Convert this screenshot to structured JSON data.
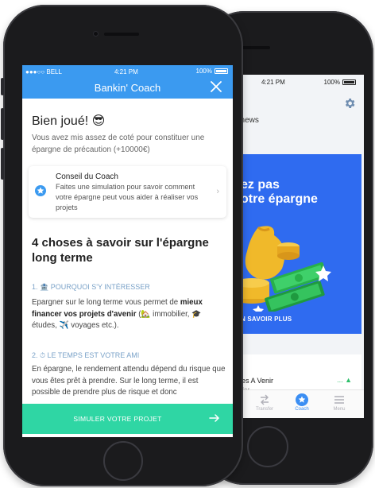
{
  "back_phone": {
    "status_time": "4:21 PM",
    "battery": "100%",
    "news_label": "t news",
    "promo_title_line1": "ez pas",
    "promo_title_line2": "otre épargne",
    "promo_cta": "N SAVOIR PLUS",
    "card_title": "ues A Venir",
    "card_subtitle": "ulier",
    "card_trend": "... ▲",
    "tabs": [
      {
        "label": "Transfer"
      },
      {
        "label": "Coach"
      },
      {
        "label": "Menu"
      }
    ],
    "accent_color": "#2f6bf0"
  },
  "front_phone": {
    "status": {
      "carrier": "●●●○○ BELL",
      "time": "4:21 PM",
      "battery": "100%"
    },
    "nav_title": "Bankin' Coach",
    "heading": "Bien joué! 😎",
    "intro": "Vous avez mis assez de coté pour constituer une épargne de précaution (+10000€)",
    "coach_card": {
      "title": "Conseil du Coach",
      "text": "Faites une simulation pour savoir comment votre épargne peut vous aider à réaliser vos projets"
    },
    "section_heading": "4 choses à savoir sur l'épargne long terme",
    "section1": {
      "title": "1. 🏦 POURQUOI S'Y INTÉRESSER",
      "text_before": "Epargner sur le long terme vous permet de ",
      "text_bold": "mieux financer vos projets d'avenir",
      "text_after1": " (🏡 immobilier, 🎓 études, ✈️ voyages etc.)."
    },
    "section2": {
      "title": "2. ⏱ LE TEMPS EST VOTRE AMI",
      "text": "En épargne, le rendement attendu dépend du risque que vous êtes prêt à prendre. Sur le long terme, il est possible de prendre plus de risque et donc"
    },
    "cta_label": "SIMULER VOTRE PROJET",
    "colors": {
      "topbar": "#3b9af0",
      "cta": "#2fd6a4"
    }
  }
}
